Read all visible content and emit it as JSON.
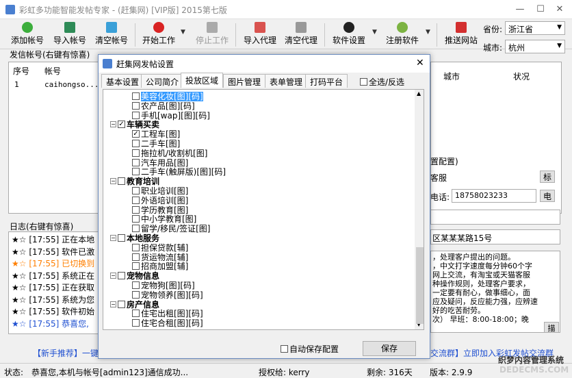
{
  "app": {
    "title": "彩虹多功能智能发帖专家 - (赶集网)    [VIP版]    2015第七版"
  },
  "colors": {
    "blue_link": "#1e4fd1",
    "orange": "#ff7f00",
    "dialog_border": "#6a8bbf"
  },
  "toolbar": {
    "add_account": "添加帐号",
    "import_account": "导入帐号",
    "clear_account": "清空帐号",
    "start": "开始工作",
    "stop": "停止工作",
    "import_proxy": "导入代理",
    "clear_proxy": "清空代理",
    "settings": "软件设置",
    "register": "注册软件",
    "push_site": "推送网站",
    "province_label": "省份:",
    "province": "浙江省",
    "city_label": "城市:",
    "city": "杭州"
  },
  "accounts": {
    "group_label": "发信帐号(右键有惊喜)",
    "col_no": "序号",
    "col_account": "帐号",
    "col_city": "城市",
    "col_status": "状况",
    "row1_no": "1",
    "row1_account": "caihongso..."
  },
  "log": {
    "group_label": "日志(右键有惊喜)",
    "rows": [
      {
        "text": "★☆ [17:55] 正在本地"
      },
      {
        "text": "★☆ [17:55] 软件已激"
      },
      {
        "text": "★☆ [17:55] 已切换到"
      },
      {
        "text": "★☆ [17:55] 系统正在"
      },
      {
        "text": "★☆ [17:55] 正在获取"
      },
      {
        "text": "★☆ [17:55] 系统为您"
      },
      {
        "text": "★☆ [17:55] 软件初始"
      },
      {
        "text": "★☆ [17:55] 恭喜您,"
      }
    ]
  },
  "right": {
    "group_label": "置配置)",
    "svc": "客服",
    "btn_biao": "标",
    "phone_label": "电话:",
    "phone": "18758023233",
    "btn_dian": "电",
    "addr": "区某某某路15号",
    "desc": "，处理客户提出的问题。\n，中文打字速度每分钟60个字\n网上交流，有淘宝或天猫客服\n种操作规则，处理客户要求，\n一定要有耐心，做事细心，面\n应及疑问，反应能力强，应辨速\n好的吃苦耐劳。\n次） 早班：8:00-18:00；晚",
    "btn_miao": "描"
  },
  "footer_link": {
    "left": "【新手推荐】一键",
    "right": "交流群】立即加入彩虹发帖交流群"
  },
  "status": {
    "label": "状态:",
    "msg": "恭喜您,本机与帐号[admin123]通信成功...",
    "auth": "授权给:   kerry",
    "remain": "剩余:   316天",
    "version": "版本:   2.9.9",
    "watermark": "织梦内容管理系统",
    "watermark2": "DEDECMS.COM"
  },
  "dialog": {
    "title": "赶集网发帖设置",
    "tabs": [
      "基本设置",
      "公司简介",
      "投放区域",
      "图片管理",
      "表单管理",
      "打码平台"
    ],
    "select_all": "全选/反选",
    "autosave": "自动保存配置",
    "save": "保存",
    "tree": [
      {
        "l": "美容化妆[图][码]",
        "lv": 2,
        "sel": true
      },
      {
        "l": "农产品[图][码]",
        "lv": 2
      },
      {
        "l": "手机[wap][图][码]",
        "lv": 2
      },
      {
        "l": "车辆买卖",
        "lv": 1,
        "bold": true,
        "chk": true
      },
      {
        "l": "工程车[图]",
        "lv": 2,
        "chk": true
      },
      {
        "l": "二手车[图]",
        "lv": 2
      },
      {
        "l": "拖拉机/收割机[图]",
        "lv": 2
      },
      {
        "l": "汽车用品[图]",
        "lv": 2
      },
      {
        "l": "二手车(触屏版)[图][码]",
        "lv": 2
      },
      {
        "l": "教育培训",
        "lv": 1,
        "bold": true
      },
      {
        "l": "职业培训[图]",
        "lv": 2
      },
      {
        "l": "外语培训[图]",
        "lv": 2
      },
      {
        "l": "学历教育[图]",
        "lv": 2
      },
      {
        "l": "中小学教育[图]",
        "lv": 2
      },
      {
        "l": "留学/移民/签证[图]",
        "lv": 2
      },
      {
        "l": "本地服务",
        "lv": 1,
        "bold": true
      },
      {
        "l": "担保贷款[辅]",
        "lv": 2
      },
      {
        "l": "货运物流[辅]",
        "lv": 2
      },
      {
        "l": "招商加盟[辅]",
        "lv": 2
      },
      {
        "l": "宠物信息",
        "lv": 1,
        "bold": true
      },
      {
        "l": "宠物狗[图][码]",
        "lv": 2
      },
      {
        "l": "宠物领养[图][码]",
        "lv": 2
      },
      {
        "l": "房产信息",
        "lv": 1,
        "bold": true
      },
      {
        "l": "住宅出租[图][码]",
        "lv": 2
      },
      {
        "l": "住宅合租[图][码]",
        "lv": 2
      }
    ]
  }
}
